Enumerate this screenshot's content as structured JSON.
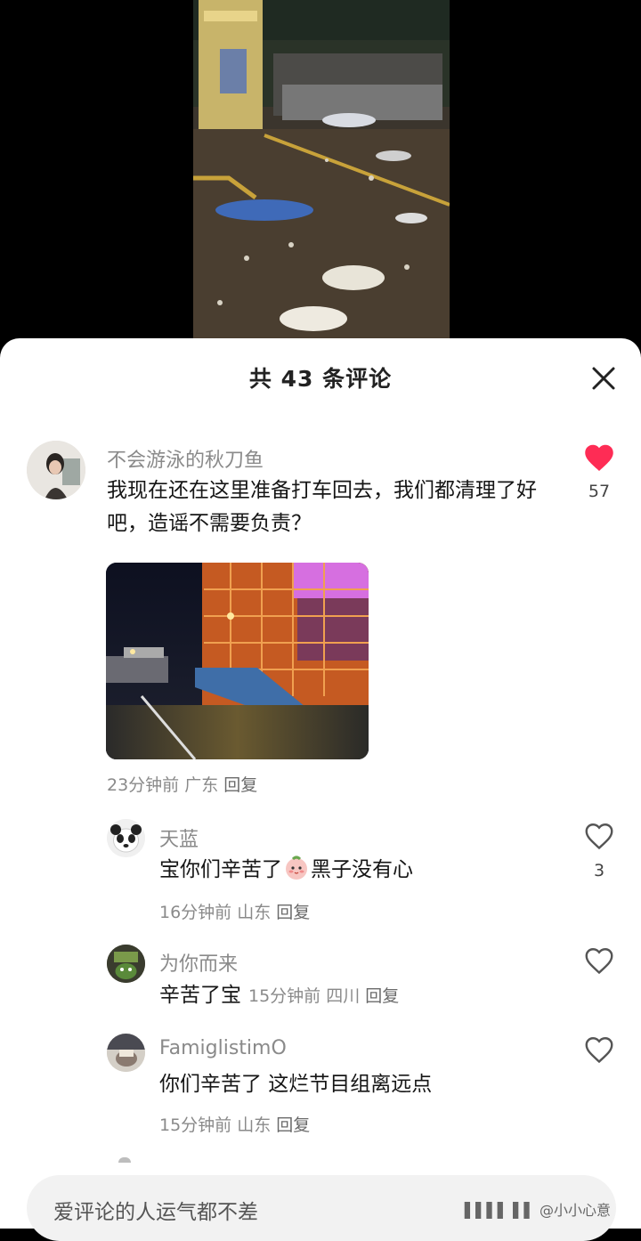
{
  "comments_title": "共 43 条评论",
  "main_comment": {
    "username": "不会游泳的秋刀鱼",
    "text": "我现在还在这里准备打车回去，我们都清理了好吧，造谣不需要负责？",
    "time": "23分钟前",
    "location": "广东",
    "reply_label": "回复",
    "like_count": "57",
    "liked": true
  },
  "replies": [
    {
      "username": "天蓝",
      "text_before": "宝你们辛苦了",
      "emoji": "peach-face-emoji",
      "text_after": "黑子没有心",
      "time": "16分钟前",
      "location": "山东",
      "reply_label": "回复",
      "like_count": "3"
    },
    {
      "username": "为你而来",
      "text": "辛苦了宝",
      "time": "15分钟前",
      "location": "四川",
      "reply_label": "回复"
    },
    {
      "username": "FamiglistimO",
      "text": "你们辛苦了 这烂节目组离远点",
      "time": "15分钟前",
      "location": "山东",
      "reply_label": "回复"
    }
  ],
  "input": {
    "placeholder": "爱评论的人运气都不差"
  },
  "watermark": "▌▌▌▌ ▌▌ @小小心意",
  "colors": {
    "like_red": "#fe2c55",
    "meta_gray": "#8a8a8a",
    "sheet_bg": "#ffffff"
  },
  "icons": {
    "close": "close-icon",
    "like": "heart-icon"
  }
}
